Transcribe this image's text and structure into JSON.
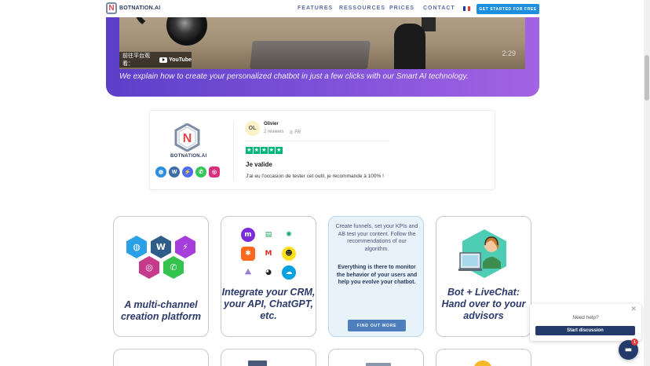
{
  "header": {
    "logo_text": "BOTNATION.AI",
    "nav": [
      "FEATURES",
      "RESSOURCES",
      "PRICES",
      "CONTACT"
    ],
    "cta_label": "GET STARTED FOR FREE"
  },
  "video": {
    "watch_on_label": "前往平台观看：",
    "youtube_label": "YouTube",
    "time": "2:29",
    "caption": "We explain how to create your personalized chatbot in just a few clicks with our Smart AI technology."
  },
  "review": {
    "brand": "BOTNATION.AI",
    "avatar_initials": "OL",
    "reviewer_name": "Olivier",
    "review_count": "2 reviews",
    "country": "FR",
    "rating": 5,
    "title": "Je valide",
    "text": "J'ai eu l'occasion de tester cet outil, je recommande à 100% !"
  },
  "features": {
    "card1_title": "A multi-channel creation platform",
    "card2_title": "Integrate your CRM, your API, ChatGPT, etc.",
    "card3_text": "Create funnels, set your KPIs and AB test your content. Follow the recommendations of our algorithm.",
    "card3_bold": "Everything is there to monitor the behavior of your users and help you evolve your chatbot.",
    "card3_button": "FIND OUT MORE",
    "card4_title": "Bot + LiveChat: Hand over to your advisors"
  },
  "chat": {
    "need_help": "Need help?",
    "start_label": "Start discussion",
    "badge": "1"
  },
  "colors": {
    "accent": "#1e8fde",
    "banner_start": "#5b3fc9",
    "banner_end": "#a463e4",
    "trustpilot_green": "#00b67a",
    "navy": "#243a6b"
  }
}
